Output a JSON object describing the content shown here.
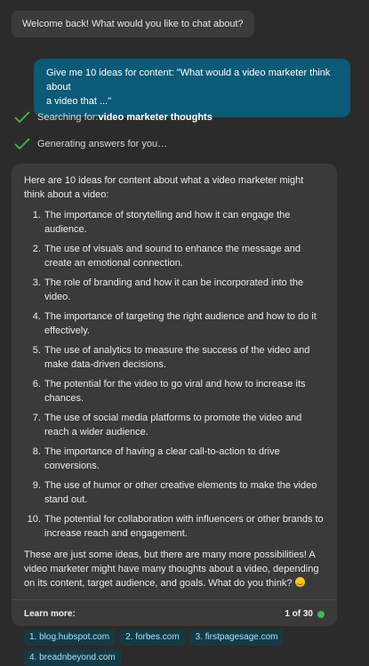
{
  "greeting": "Welcome back! What would you like to chat about?",
  "user_message": {
    "line1": "Give me 10 ideas for content: \"What would a video marketer think about",
    "line2": "a video that ...\""
  },
  "status": {
    "searching_prefix": "Searching for: ",
    "searching_query": "video marketer thoughts",
    "generating": "Generating answers for you…"
  },
  "answer": {
    "intro": "Here are 10 ideas for content about what a video marketer might think about a video:",
    "items": [
      "The importance of storytelling and how it can engage the audience.",
      "The use of visuals and sound to enhance the message and create an emotional connection.",
      "The role of branding and how it can be incorporated into the video.",
      "The importance of targeting the right audience and how to do it effectively.",
      "The use of analytics to measure the success of the video and make data-driven decisions.",
      "The potential for the video to go viral and how to increase its chances.",
      "The use of social media platforms to promote the video and reach a wider audience.",
      "The importance of having a clear call-to-action to drive conversions.",
      "The use of humor or other creative elements to make the video stand out.",
      "The potential for collaboration with influencers or other brands to increase reach and engagement."
    ],
    "closing": "These are just some ideas, but there are many more possibilities! A video marketer might have many thoughts about a video, depending on its content, target audience, and goals. What do you think?"
  },
  "learn_more": {
    "label": "Learn more:",
    "pager": "1 of 30",
    "links": [
      "1. blog.hubspot.com",
      "2. forbes.com",
      "3. firstpagesage.com",
      "4. breadnbeyond.com"
    ]
  },
  "colors": {
    "user_bubble": "#0b5a78",
    "check": "#3fb950",
    "link_text": "#9fe3ff"
  }
}
